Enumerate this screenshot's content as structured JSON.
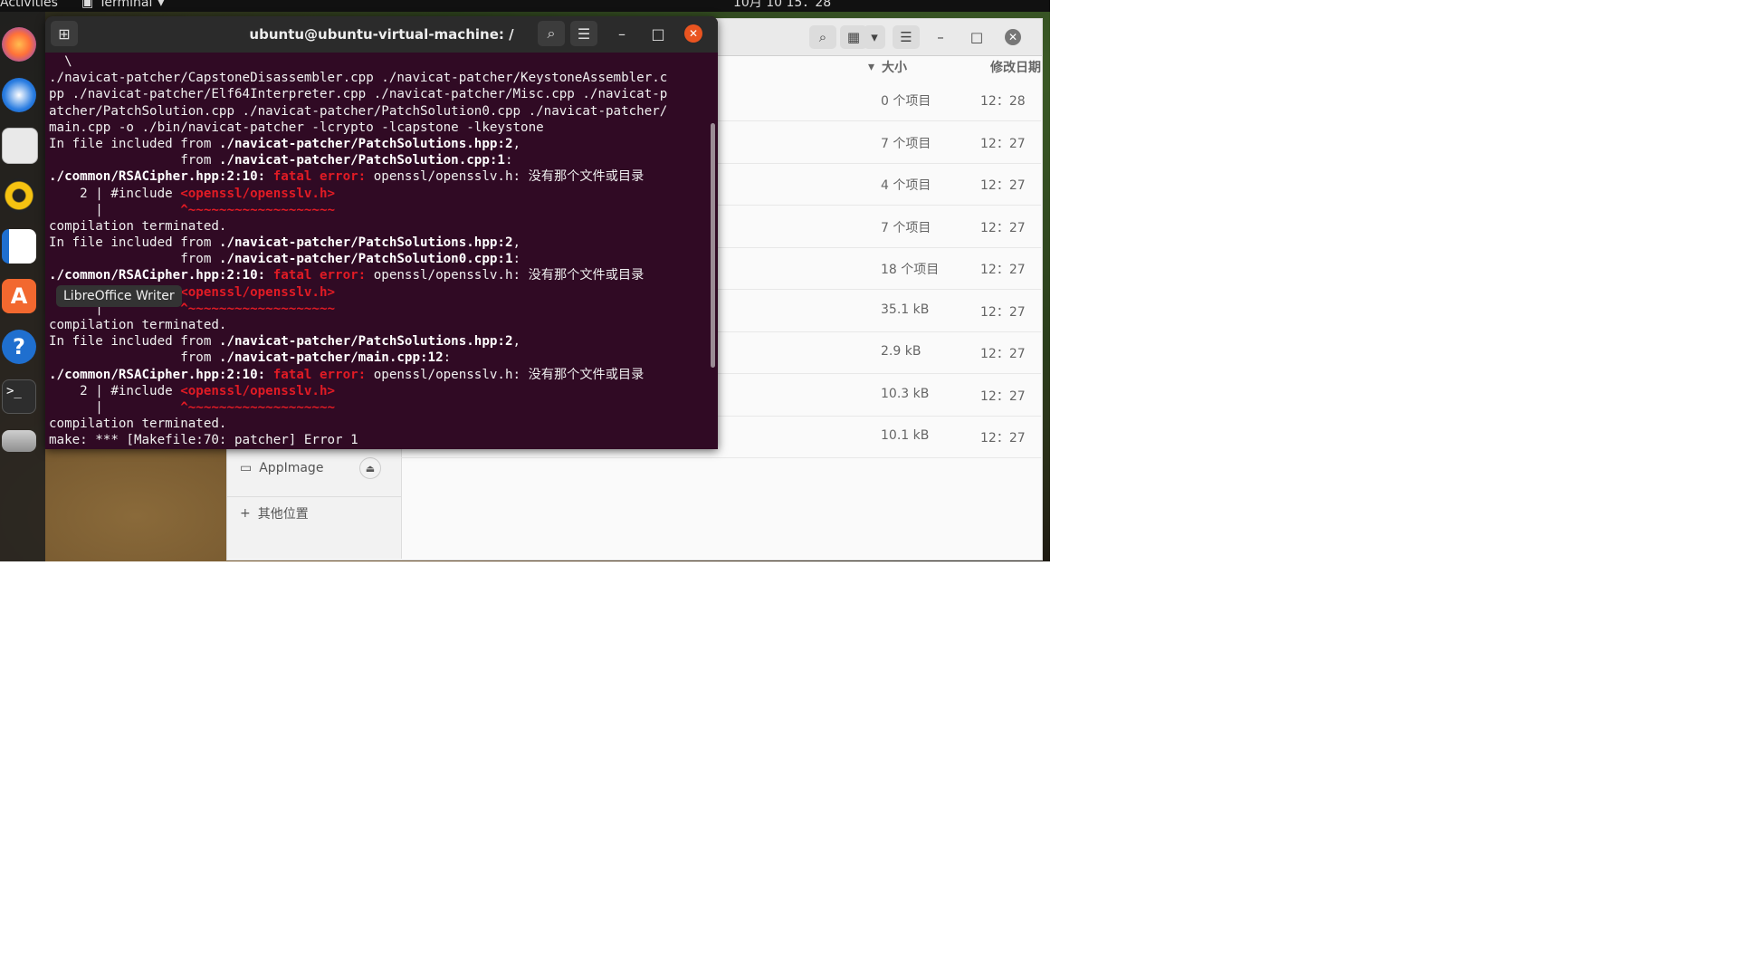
{
  "topbar": {
    "activities": "Activities",
    "app_menu": "Terminal",
    "clock": "10月 10  15：28"
  },
  "dock": {
    "tooltip": "LibreOffice Writer",
    "items": [
      {
        "name": "firefox-icon"
      },
      {
        "name": "thunderbird-icon"
      },
      {
        "name": "files-icon"
      },
      {
        "name": "rhythmbox-icon"
      },
      {
        "name": "libreoffice-writer-icon"
      },
      {
        "name": "software-center-icon",
        "glyph": "A"
      },
      {
        "name": "help-icon",
        "glyph": "?"
      },
      {
        "name": "terminal-icon",
        "glyph": ">_"
      },
      {
        "name": "disk-icon"
      }
    ]
  },
  "terminal": {
    "title": "ubuntu@ubuntu-virtual-machine: /",
    "lines": [
      [
        {
          "t": "  \\"
        }
      ],
      [
        {
          "t": "./navicat-patcher/CapstoneDisassembler.cpp ./navicat-patcher/KeystoneAssembler.c"
        }
      ],
      [
        {
          "t": "pp ./navicat-patcher/Elf64Interpreter.cpp ./navicat-patcher/Misc.cpp ./navicat-p"
        }
      ],
      [
        {
          "t": "atcher/PatchSolution.cpp ./navicat-patcher/PatchSolution0.cpp ./navicat-patcher/"
        }
      ],
      [
        {
          "t": "main.cpp -o ./bin/navicat-patcher -lcrypto -lcapstone -lkeystone"
        }
      ],
      [
        {
          "t": "In file included from "
        },
        {
          "t": "./navicat-patcher/PatchSolutions.hpp:2",
          "c": "b"
        },
        {
          "t": ","
        }
      ],
      [
        {
          "t": "                 from "
        },
        {
          "t": "./navicat-patcher/PatchSolution.cpp:1",
          "c": "b"
        },
        {
          "t": ":"
        }
      ],
      [
        {
          "t": "./common/RSACipher.hpp:2:10: ",
          "c": "b"
        },
        {
          "t": "fatal error: ",
          "c": "rb"
        },
        {
          "t": "openssl/opensslv.h: 没有那个文件或目录"
        }
      ],
      [
        {
          "t": "    2 | #include "
        },
        {
          "t": "<openssl/opensslv.h>",
          "c": "rb"
        }
      ],
      [
        {
          "t": "      |          "
        },
        {
          "t": "^~~~~~~~~~~~~~~~~~~~",
          "c": "rb"
        }
      ],
      [
        {
          "t": "compilation terminated."
        }
      ],
      [
        {
          "t": "In file included from "
        },
        {
          "t": "./navicat-patcher/PatchSolutions.hpp:2",
          "c": "b"
        },
        {
          "t": ","
        }
      ],
      [
        {
          "t": "                 from "
        },
        {
          "t": "./navicat-patcher/PatchSolution0.cpp:1",
          "c": "b"
        },
        {
          "t": ":"
        }
      ],
      [
        {
          "t": "./common/RSACipher.hpp:2:10: ",
          "c": "b"
        },
        {
          "t": "fatal error: ",
          "c": "rb"
        },
        {
          "t": "openssl/opensslv.h: 没有那个文件或目录"
        }
      ],
      [
        {
          "t": "    2 | #include "
        },
        {
          "t": "<openssl/opensslv.h>",
          "c": "rb"
        }
      ],
      [
        {
          "t": "      |          "
        },
        {
          "t": "^~~~~~~~~~~~~~~~~~~~",
          "c": "rb"
        }
      ],
      [
        {
          "t": "compilation terminated."
        }
      ],
      [
        {
          "t": "In file included from "
        },
        {
          "t": "./navicat-patcher/PatchSolutions.hpp:2",
          "c": "b"
        },
        {
          "t": ","
        }
      ],
      [
        {
          "t": "                 from "
        },
        {
          "t": "./navicat-patcher/main.cpp:12",
          "c": "b"
        },
        {
          "t": ":"
        }
      ],
      [
        {
          "t": "./common/RSACipher.hpp:2:10: ",
          "c": "b"
        },
        {
          "t": "fatal error: ",
          "c": "rb"
        },
        {
          "t": "openssl/opensslv.h: 没有那个文件或目录"
        }
      ],
      [
        {
          "t": "    2 | #include "
        },
        {
          "t": "<openssl/opensslv.h>",
          "c": "rb"
        }
      ],
      [
        {
          "t": "      |          "
        },
        {
          "t": "^~~~~~~~~~~~~~~~~~~~",
          "c": "rb"
        }
      ],
      [
        {
          "t": "compilation terminated."
        }
      ],
      [
        {
          "t": "make: *** [Makefile:70: patcher] Error 1"
        }
      ]
    ]
  },
  "files": {
    "columns": {
      "size": "大小",
      "modified": "修改日期"
    },
    "rows": [
      {
        "size": "0 个项目",
        "date": "12：28"
      },
      {
        "size": "7 个项目",
        "date": "12：27"
      },
      {
        "size": "4 个项目",
        "date": "12：27"
      },
      {
        "size": "7 个项目",
        "date": "12：27"
      },
      {
        "size": "18 个项目",
        "date": "12：27"
      },
      {
        "size": "35.1 kB",
        "date": "12：27"
      },
      {
        "size": "2.9 kB",
        "date": "12：27"
      },
      {
        "size": "10.3 kB",
        "date": "12：27"
      },
      {
        "size": "10.1 kB",
        "date": "12：27"
      }
    ],
    "sidebar": {
      "appimage": "AppImage",
      "other_locations": "其他位置"
    }
  }
}
